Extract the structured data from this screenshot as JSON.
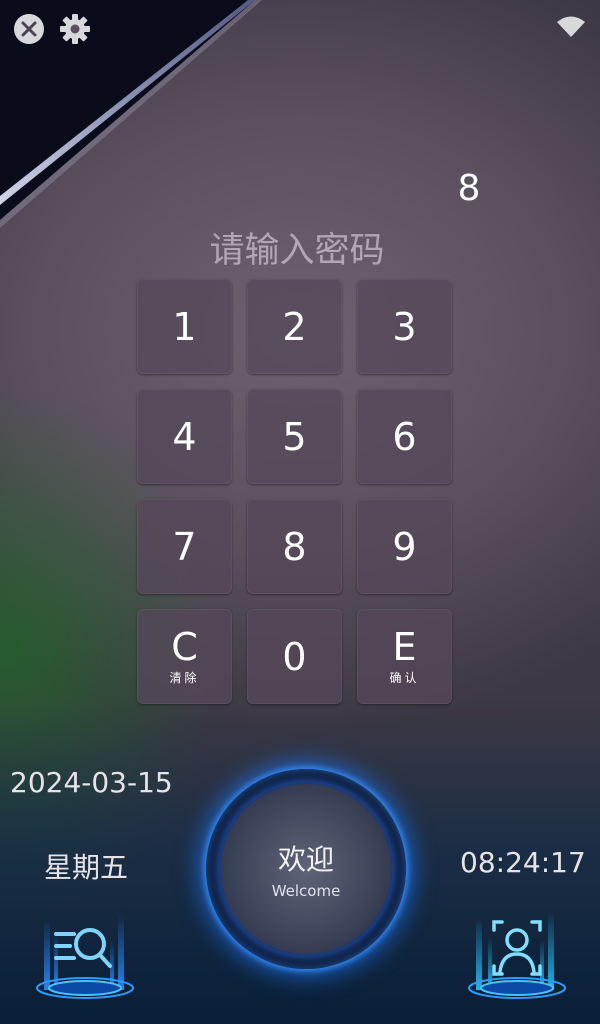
{
  "header": {
    "icons": [
      "close-icon",
      "gear-icon",
      "wifi-icon"
    ]
  },
  "password": {
    "entered_digits": "8",
    "prompt": "请输入密码"
  },
  "keypad": {
    "keys": [
      {
        "main": "1",
        "sub": ""
      },
      {
        "main": "2",
        "sub": ""
      },
      {
        "main": "3",
        "sub": ""
      },
      {
        "main": "4",
        "sub": ""
      },
      {
        "main": "5",
        "sub": ""
      },
      {
        "main": "6",
        "sub": ""
      },
      {
        "main": "7",
        "sub": ""
      },
      {
        "main": "8",
        "sub": ""
      },
      {
        "main": "9",
        "sub": ""
      },
      {
        "main": "C",
        "sub": "清除"
      },
      {
        "main": "0",
        "sub": ""
      },
      {
        "main": "E",
        "sub": "确认"
      }
    ]
  },
  "status": {
    "date": "2024-03-15",
    "weekday": "星期五",
    "time": "08:24:17"
  },
  "welcome": {
    "title": "欢迎",
    "subtitle": "Welcome"
  },
  "bottom": {
    "icons": [
      "search-record-icon",
      "face-recognition-icon"
    ]
  },
  "colors": {
    "accent": "#1e78ff",
    "glow": "#3fa9ff"
  }
}
